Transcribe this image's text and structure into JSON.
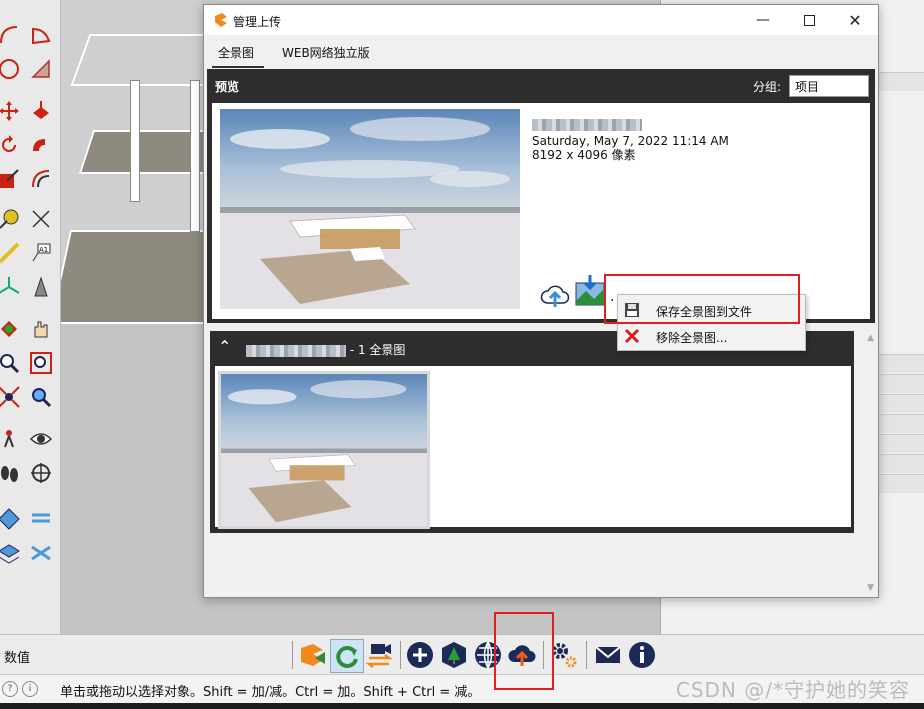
{
  "dialog": {
    "title": "管理上传",
    "tabs": [
      {
        "label": "全景图",
        "active": true
      },
      {
        "label": "WEB网络独立版",
        "active": false
      }
    ],
    "preview": {
      "header": "预览",
      "group_label": "分组:",
      "group_value": "项目",
      "date": "Saturday, May 7, 2022 11:14 AM",
      "size": "8192 x 4096 像素",
      "more_label": "..."
    },
    "context_menu": [
      {
        "label": "保存全景图到文件",
        "icon": "floppy-disk-icon"
      },
      {
        "label": "移除全景图...",
        "icon": "red-x-icon"
      }
    ],
    "group": {
      "count_label": "- 1 全景图"
    }
  },
  "bottom_bar": {
    "label": "数值"
  },
  "status_bar": {
    "message": "单击或拖动以选择对象。Shift = 加/减。Ctrl = 加。Shift + Ctrl = 减。"
  },
  "watermark": "CSDN @/*守护她的笑容",
  "colors": {
    "panel_dark": "#2d2d2d",
    "highlight_red": "#e02020",
    "accent_orange": "#f08a1c"
  }
}
